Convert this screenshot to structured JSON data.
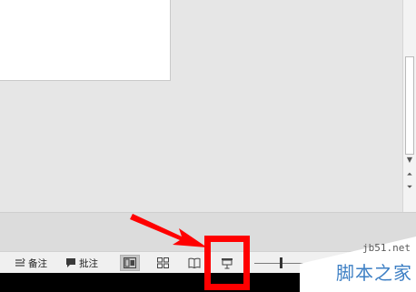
{
  "status_bar": {
    "notes_label": "备注",
    "comments_label": "批注",
    "view_buttons": [
      {
        "name": "normal-view",
        "icon": "normal-view-icon"
      },
      {
        "name": "slide-sorter-view",
        "icon": "slide-sorter-icon"
      },
      {
        "name": "reading-view",
        "icon": "reading-view-icon"
      },
      {
        "name": "slideshow-view",
        "icon": "slideshow-icon"
      }
    ],
    "active_view": "normal-view"
  },
  "annotation": {
    "highlight_color": "#ff0000",
    "arrow_color": "#ff0000"
  },
  "watermark": {
    "url": "jb51.net",
    "text": "脚本之家"
  }
}
